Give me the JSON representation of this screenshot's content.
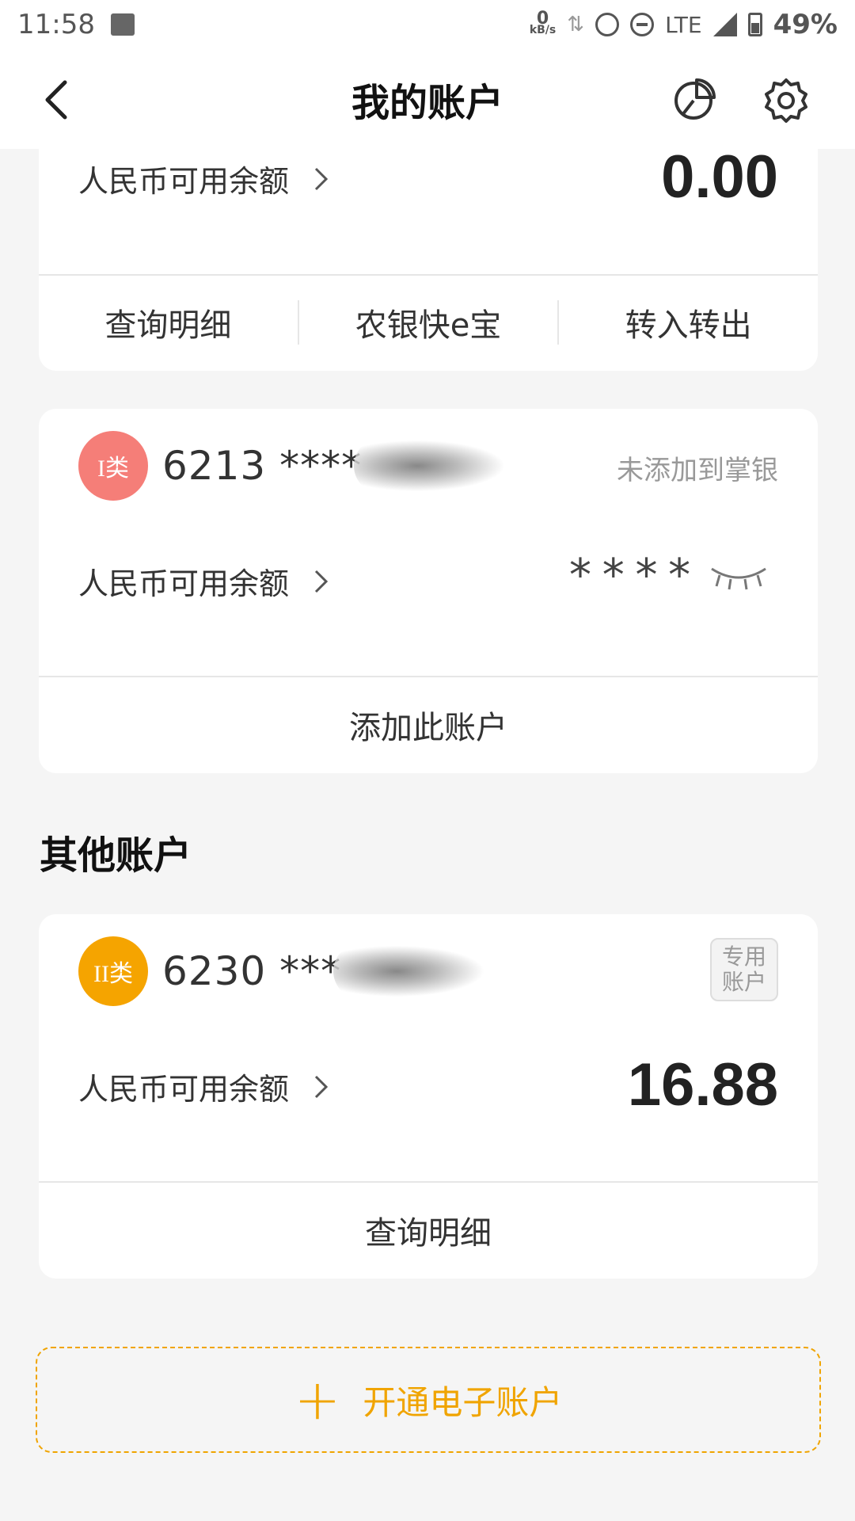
{
  "status_bar": {
    "time": "11:58",
    "net_speed": "0",
    "net_unit": "kB/s",
    "network": "LTE",
    "battery": "49%"
  },
  "nav": {
    "title": "我的账户",
    "icons": [
      "back-arrow-icon",
      "pie-chart-icon",
      "gear-icon"
    ]
  },
  "top_account": {
    "balance_label": "人民币可用余额",
    "balance": "0.00",
    "actions": [
      "查询明细",
      "农银快e宝",
      "转入转出"
    ]
  },
  "account_i": {
    "badge": "I类",
    "number": "6213 ****",
    "note": "未添加到掌银",
    "balance_label": "人民币可用余额",
    "balance_hidden": "****",
    "action": "添加此账户"
  },
  "other_section": {
    "title": "其他账户"
  },
  "account_ii": {
    "badge": "II类",
    "number": "6230 ***",
    "tag_line1": "专用",
    "tag_line2": "账户",
    "balance_label": "人民币可用余额",
    "balance": "16.88",
    "action": "查询明细"
  },
  "open_account": {
    "label": "开通电子账户"
  },
  "colors": {
    "accent": "#f0a400",
    "badge_i": "#f57e78",
    "badge_ii": "#f5a400",
    "background": "#f5f5f5"
  }
}
